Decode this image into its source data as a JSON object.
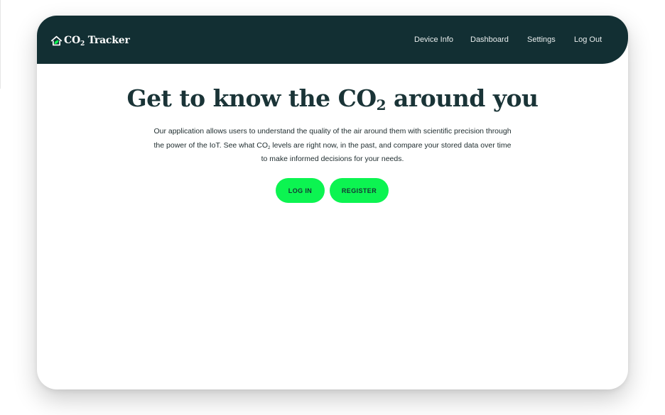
{
  "brand": {
    "logo_icon": "house-leaf-icon",
    "name_prefix": "CO",
    "name_subscript": "2",
    "name_suffix": " Tracker"
  },
  "nav": {
    "items": [
      {
        "label": "Device Info"
      },
      {
        "label": "Dashboard"
      },
      {
        "label": "Settings"
      },
      {
        "label": "Log Out"
      }
    ]
  },
  "hero": {
    "title_prefix": "Get to know the CO",
    "title_subscript": "2",
    "title_suffix": " around you",
    "description_part1": "Our application allows users to understand the quality of the air around them with scientific precision through the power of the IoT. See what CO",
    "description_subscript": "2",
    "description_part2": " levels are right now, in the past, and compare your stored data over time to make informed decisions for your needs.",
    "login_label": "LOG IN",
    "register_label": "REGISTER"
  },
  "colors": {
    "navbar_bg": "#122f33",
    "accent_green": "#0cf451",
    "heading_text": "#1a3437",
    "body_text": "#1d2b2d",
    "page_bg": "#ffffff"
  }
}
